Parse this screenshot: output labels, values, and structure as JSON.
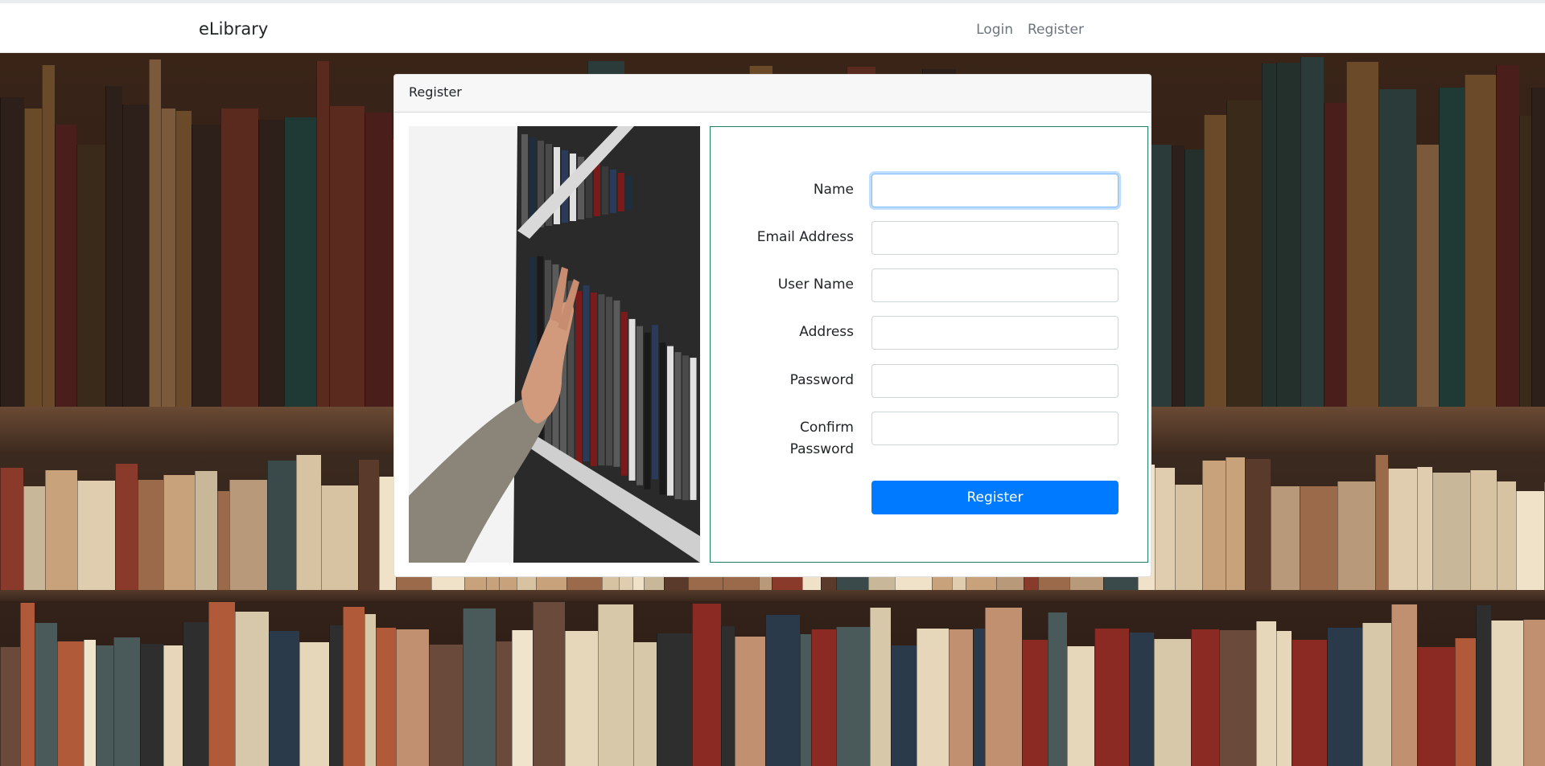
{
  "nav": {
    "brand": "eLibrary",
    "links": [
      "Login",
      "Register"
    ]
  },
  "card": {
    "header": "Register"
  },
  "form": {
    "fields": [
      {
        "label": "Name",
        "value": "",
        "type": "text"
      },
      {
        "label": "Email Address",
        "value": "",
        "type": "email"
      },
      {
        "label": "User Name",
        "value": "",
        "type": "text"
      },
      {
        "label": "Address",
        "value": "",
        "type": "text"
      },
      {
        "label": "Password",
        "value": "",
        "type": "password"
      },
      {
        "label": "Confirm Password",
        "value": "",
        "type": "password"
      }
    ],
    "submit_label": "Register"
  },
  "colors": {
    "primary": "#007bff",
    "form_border": "#1e7e64",
    "nav_link": "#6c757d"
  }
}
